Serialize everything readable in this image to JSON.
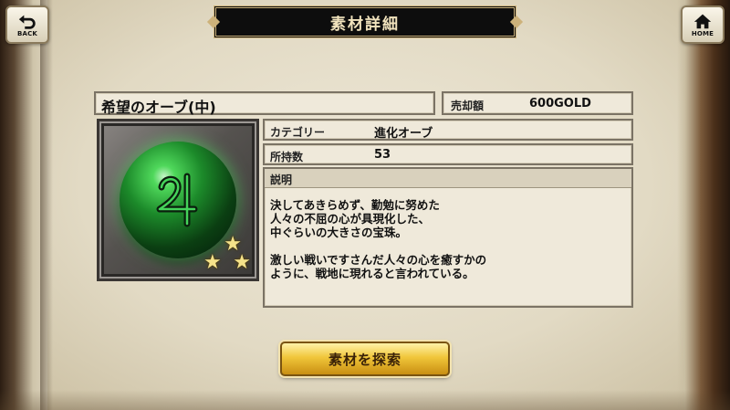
{
  "nav": {
    "back_label": "BACK",
    "home_label": "HOME"
  },
  "header": {
    "title": "素材詳細"
  },
  "item": {
    "name": "希望のオーブ(中)",
    "price_label": "売却額",
    "price_value": "600GOLD",
    "category_label": "カテゴリー",
    "category_value": "進化オーブ",
    "owned_label": "所持数",
    "owned_value": "53",
    "rarity_stars": 3,
    "icon": "green-jupiter-orb-icon",
    "description_label": "説明",
    "description_lines": [
      "決してあきらめず、勤勉に努めた",
      "人々の不屈の心が具現化した、",
      "中ぐらいの大きさの宝珠。",
      "",
      "激しい戦いですさんだ人々の心を癒すかの",
      "ように、戦地に現れると言われている。"
    ]
  },
  "actions": {
    "search_label": "素材を探索"
  }
}
